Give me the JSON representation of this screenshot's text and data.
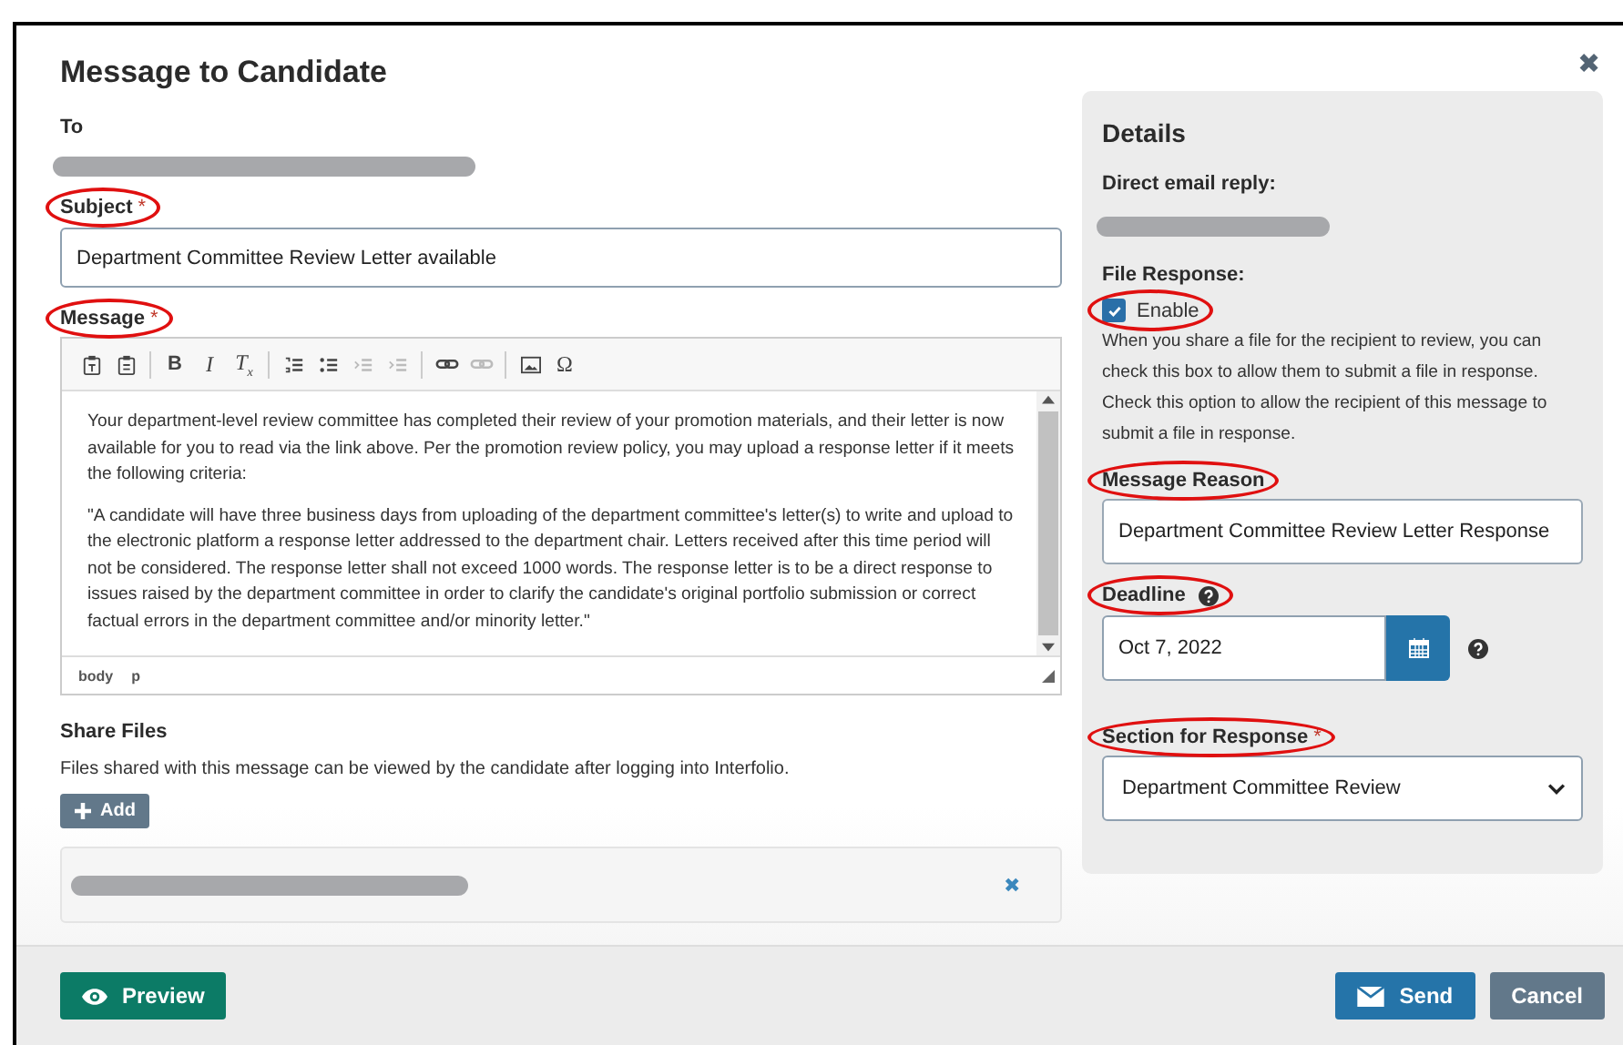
{
  "dialog": {
    "title": "Message to Candidate",
    "close": "✖"
  },
  "to": {
    "label": "To"
  },
  "subject": {
    "label": "Subject",
    "required_mark": "*",
    "circled": true,
    "value": "Department Committee Review Letter available"
  },
  "message": {
    "label": "Message",
    "required_mark": "*",
    "circled": true,
    "toolbar": [
      {
        "kind": "paste",
        "disabled": false
      },
      {
        "kind": "paste-text",
        "disabled": false
      },
      {
        "kind": "sep"
      },
      {
        "kind": "bold",
        "label": "B",
        "disabled": false
      },
      {
        "kind": "italic",
        "label": "I",
        "disabled": false
      },
      {
        "kind": "clear",
        "label": "T$_{x}$",
        "disabled": false
      },
      {
        "kind": "sep"
      },
      {
        "kind": "ol",
        "disabled": false
      },
      {
        "kind": "ul",
        "disabled": false
      },
      {
        "kind": "outdent",
        "disabled": true
      },
      {
        "kind": "indent",
        "disabled": true
      },
      {
        "kind": "sep"
      },
      {
        "kind": "link",
        "disabled": false
      },
      {
        "kind": "unlink",
        "disabled": true
      },
      {
        "kind": "sep"
      },
      {
        "kind": "image",
        "disabled": false
      },
      {
        "kind": "special",
        "label": "Ω",
        "disabled": false
      }
    ],
    "paragraphs": [
      "Your department-level review committee has completed their review of your promotion materials, and their letter is now available for you to read via the link above. Per the promotion review policy, you may upload a response letter if it meets the following criteria:",
      "\"A candidate will have three business days from uploading of the department committee's letter(s) to write and upload to the electronic platform a response letter addressed to the department chair. Letters received after this time period will not be considered. The response letter shall not exceed 1000 words. The response letter is to be a direct response to issues raised by the department committee in order to clarify the candidate's original portfolio submission or correct factual errors in the department committee and/or minority letter.\""
    ],
    "path": [
      "body",
      "p"
    ]
  },
  "share_files": {
    "title": "Share Files",
    "description": "Files shared with this message can be viewed by the candidate after logging into Interfolio.",
    "add_button": "Add",
    "remove": "✖"
  },
  "details": {
    "title": "Details",
    "direct_email_label": "Direct email reply:",
    "file_response": {
      "label": "File Response:",
      "checkbox": {
        "label": "Enable",
        "checked": true,
        "circled": true
      },
      "help": "When you share a file for the recipient to review, you can check this box to allow them to submit a file in response. Check this option to allow the recipient of this message to submit a file in response."
    },
    "message_reason": {
      "label": "Message Reason",
      "circled": true,
      "value": "Department Committee Review Letter Response"
    },
    "deadline": {
      "label": "Deadline",
      "circled": true,
      "value": "Oct 7, 2022"
    },
    "section": {
      "label": "Section for Response",
      "required_mark": "*",
      "circled": true,
      "value": "Department Committee Review"
    }
  },
  "footer": {
    "preview": "Preview",
    "send": "Send",
    "cancel": "Cancel"
  }
}
